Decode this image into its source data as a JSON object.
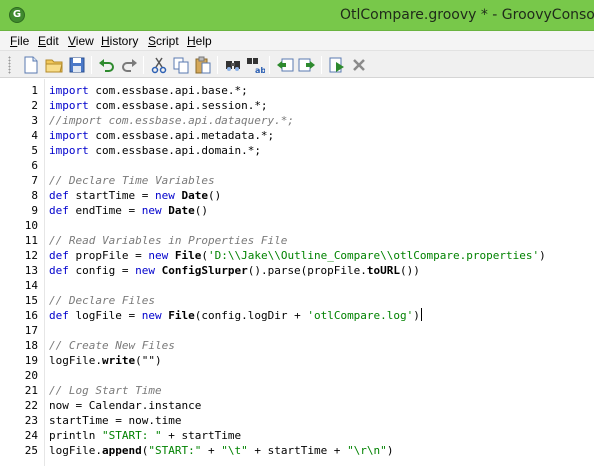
{
  "window": {
    "title": "OtlCompare.groovy * - GroovyConsole",
    "icon_letter": "G"
  },
  "menu": [
    {
      "label": "File",
      "mnemonic": "F",
      "rest": "ile"
    },
    {
      "label": "Edit",
      "mnemonic": "E",
      "rest": "dit"
    },
    {
      "label": "View",
      "mnemonic": "V",
      "rest": "iew"
    },
    {
      "label": "History",
      "mnemonic": "H",
      "rest": "istory"
    },
    {
      "label": "Script",
      "mnemonic": "S",
      "rest": "cript"
    },
    {
      "label": "Help",
      "mnemonic": "H",
      "rest": "elp"
    }
  ],
  "toolbar": [
    "new-file-icon",
    "open-icon",
    "save-icon",
    "undo-icon",
    "redo-icon",
    "cut-icon",
    "copy-icon",
    "paste-icon",
    "find-icon",
    "replace-icon",
    "history-prev-icon",
    "history-next-icon",
    "run-icon",
    "interrupt-icon"
  ],
  "colors": {
    "titlebar": "#78c84a",
    "keyword": "#0000cc",
    "comment": "#7a7a7a",
    "string": "#008200"
  },
  "editor": {
    "lines": [
      [
        {
          "t": "kw",
          "v": "import"
        },
        {
          "t": "p",
          "v": " com.essbase.api.base.*;"
        }
      ],
      [
        {
          "t": "kw",
          "v": "import"
        },
        {
          "t": "p",
          "v": " com.essbase.api.session.*;"
        }
      ],
      [
        {
          "t": "cm",
          "v": "//import com.essbase.api.dataquery.*;"
        }
      ],
      [
        {
          "t": "kw",
          "v": "import"
        },
        {
          "t": "p",
          "v": " com.essbase.api.metadata.*;"
        }
      ],
      [
        {
          "t": "kw",
          "v": "import"
        },
        {
          "t": "p",
          "v": " com.essbase.api.domain.*;"
        }
      ],
      [],
      [
        {
          "t": "cm",
          "v": "// Declare Time Variables"
        }
      ],
      [
        {
          "t": "kw",
          "v": "def"
        },
        {
          "t": "p",
          "v": " startTime = "
        },
        {
          "t": "kw",
          "v": "new"
        },
        {
          "t": "p",
          "v": " "
        },
        {
          "t": "cls",
          "v": "Date"
        },
        {
          "t": "p",
          "v": "()"
        }
      ],
      [
        {
          "t": "kw",
          "v": "def"
        },
        {
          "t": "p",
          "v": " endTime = "
        },
        {
          "t": "kw",
          "v": "new"
        },
        {
          "t": "p",
          "v": " "
        },
        {
          "t": "cls",
          "v": "Date"
        },
        {
          "t": "p",
          "v": "()"
        }
      ],
      [],
      [
        {
          "t": "cm",
          "v": "// Read Variables in Properties File"
        }
      ],
      [
        {
          "t": "kw",
          "v": "def"
        },
        {
          "t": "p",
          "v": " propFile = "
        },
        {
          "t": "kw",
          "v": "new"
        },
        {
          "t": "p",
          "v": " "
        },
        {
          "t": "cls",
          "v": "File"
        },
        {
          "t": "p",
          "v": "("
        },
        {
          "t": "str",
          "v": "'D:\\\\Jake\\\\Outline_Compare\\\\otlCompare.properties'"
        },
        {
          "t": "p",
          "v": ")"
        }
      ],
      [
        {
          "t": "kw",
          "v": "def"
        },
        {
          "t": "p",
          "v": " config = "
        },
        {
          "t": "kw",
          "v": "new"
        },
        {
          "t": "p",
          "v": " "
        },
        {
          "t": "cls",
          "v": "ConfigSlurper"
        },
        {
          "t": "p",
          "v": "().parse(propFile."
        },
        {
          "t": "cls",
          "v": "toURL"
        },
        {
          "t": "p",
          "v": "())"
        }
      ],
      [],
      [
        {
          "t": "cm",
          "v": "// Declare Files"
        }
      ],
      [
        {
          "t": "kw",
          "v": "def"
        },
        {
          "t": "p",
          "v": " logFile = "
        },
        {
          "t": "kw",
          "v": "new"
        },
        {
          "t": "p",
          "v": " "
        },
        {
          "t": "cls",
          "v": "File"
        },
        {
          "t": "p",
          "v": "(config.logDir + "
        },
        {
          "t": "str",
          "v": "'otlCompare.log'"
        },
        {
          "t": "p",
          "v": ")"
        },
        {
          "t": "caret",
          "v": ""
        }
      ],
      [],
      [
        {
          "t": "cm",
          "v": "// Create New Files"
        }
      ],
      [
        {
          "t": "p",
          "v": "logFile."
        },
        {
          "t": "cls",
          "v": "write"
        },
        {
          "t": "p",
          "v": "(\"\")"
        }
      ],
      [],
      [
        {
          "t": "cm",
          "v": "// Log Start Time"
        }
      ],
      [
        {
          "t": "p",
          "v": "now = Calendar.instance"
        }
      ],
      [
        {
          "t": "p",
          "v": "startTime = now.time"
        }
      ],
      [
        {
          "t": "p",
          "v": "println "
        },
        {
          "t": "str",
          "v": "\"START: \""
        },
        {
          "t": "p",
          "v": " + startTime"
        }
      ],
      [
        {
          "t": "p",
          "v": "logFile."
        },
        {
          "t": "cls",
          "v": "append"
        },
        {
          "t": "p",
          "v": "("
        },
        {
          "t": "str",
          "v": "\"START:\""
        },
        {
          "t": "p",
          "v": " + "
        },
        {
          "t": "str",
          "v": "\"\\t\""
        },
        {
          "t": "p",
          "v": " + startTime + "
        },
        {
          "t": "str",
          "v": "\"\\r\\n\""
        },
        {
          "t": "p",
          "v": ")"
        }
      ]
    ]
  }
}
